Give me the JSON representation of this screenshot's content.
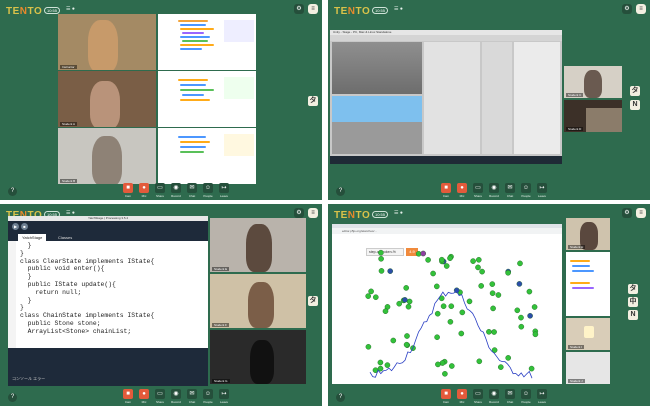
{
  "app": {
    "logo_prefix": "TE",
    "logo_o": "N",
    "logo_suffix": "TO",
    "pill_label": "10:55",
    "mini_label": "☰ ●"
  },
  "toolbar": {
    "buttons": [
      {
        "icon": "camera-icon",
        "glyph": "■",
        "label": "Cam",
        "red": true
      },
      {
        "icon": "mic-icon",
        "glyph": "●",
        "label": "Mic",
        "red": true
      },
      {
        "icon": "share-icon",
        "glyph": "▭",
        "label": "Share",
        "red": false
      },
      {
        "icon": "record-icon",
        "glyph": "◉",
        "label": "Record",
        "red": false
      },
      {
        "icon": "chat-icon",
        "glyph": "✉",
        "label": "Chat",
        "red": false
      },
      {
        "icon": "people-icon",
        "glyph": "☺",
        "label": "People",
        "red": false
      },
      {
        "icon": "leave-icon",
        "glyph": "↦",
        "label": "Leave",
        "red": false
      }
    ]
  },
  "panel1": {
    "side_button": "タ",
    "video_names": [
      "Instructor",
      "Student A",
      "Student B"
    ]
  },
  "panel2": {
    "side_buttons": [
      "タ",
      "N"
    ],
    "editor_title": "Unity - Stage - PC, Mac & Linux Standalone",
    "video_names": [
      "Student C",
      "Student D"
    ]
  },
  "panel3": {
    "side_button": "タ",
    "window_title": "YatchStage | Processing 3.5.4",
    "tabs": [
      "YatchStage",
      "Classes"
    ],
    "code_lines": [
      "  }",
      "}",
      "",
      "class ClearState implements IState{",
      "  public void enter(){",
      "  }",
      "  public IState update(){",
      "    return null;",
      "  }",
      "}",
      "",
      "class ChainState implements IState{",
      "  public Stone stone;",
      "  ArrayList<Stone> chainList;"
    ],
    "bottom_bar": "コンソール   エラー",
    "video_names": [
      "Student E",
      "Student F",
      "Student G"
    ]
  },
  "panel4": {
    "side_buttons": [
      "タ",
      "中",
      "N"
    ],
    "url": "editor.p5js.org/sketches/...",
    "overlay_label": "step-of-broken-%",
    "overlay_value": "4.9",
    "video_names": [
      "Student H",
      "Student I",
      "Student J"
    ]
  }
}
